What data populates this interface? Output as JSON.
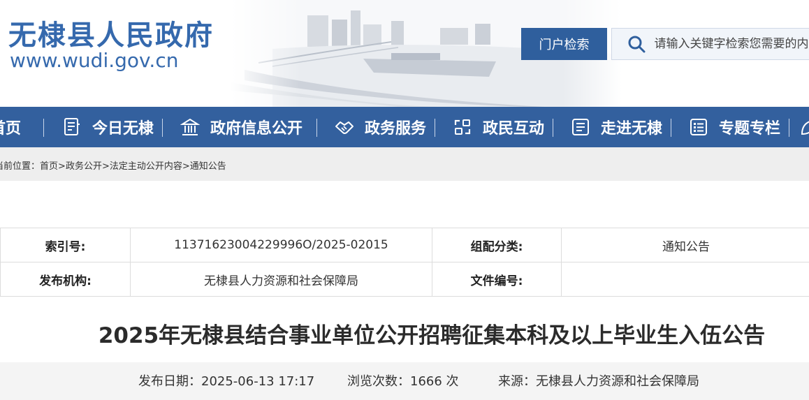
{
  "header": {
    "site_title": "无棣县人民政府",
    "site_domain": "www.wudi.gov.cn",
    "portal_search_label": "门户检索",
    "search_placeholder": "请输入关键字检索您需要的内容"
  },
  "nav": {
    "items": [
      {
        "label": "首页",
        "icon": "home-icon"
      },
      {
        "label": "今日无棣",
        "icon": "document-icon"
      },
      {
        "label": "政府信息公开",
        "icon": "government-building-icon"
      },
      {
        "label": "政务服务",
        "icon": "handshake-icon"
      },
      {
        "label": "政民互动",
        "icon": "interaction-icon"
      },
      {
        "label": "走进无棣",
        "icon": "news-icon"
      },
      {
        "label": "专题专栏",
        "icon": "list-icon"
      }
    ]
  },
  "breadcrumb": {
    "prefix": "当前位置：",
    "items": [
      "首页",
      "政务公开",
      "法定主动公开内容",
      "通知公告"
    ],
    "separator": ">"
  },
  "meta": {
    "index_label": "索引号:",
    "index_value": "11371623004229996O/2025-02015",
    "category_label": "组配分类:",
    "category_value": "通知公告",
    "publisher_label": "发布机构:",
    "publisher_value": "无棣县人力资源和社会保障局",
    "doc_no_label": "文件编号:",
    "doc_no_value": ""
  },
  "article": {
    "title": "2025年无棣县结合事业单位公开招聘征集本科及以上毕业生入伍公告",
    "date_label": "发布日期：",
    "date_value": "2025-06-13 17:17",
    "views_label": "浏览次数：",
    "views_value": "1666 次",
    "source_label": "来源：",
    "source_value": "无棣县人力资源和社会保障局"
  },
  "colors": {
    "brand_blue": "#33609e",
    "title_blue": "#3569ad",
    "crumb_bg": "#eeeeee"
  }
}
